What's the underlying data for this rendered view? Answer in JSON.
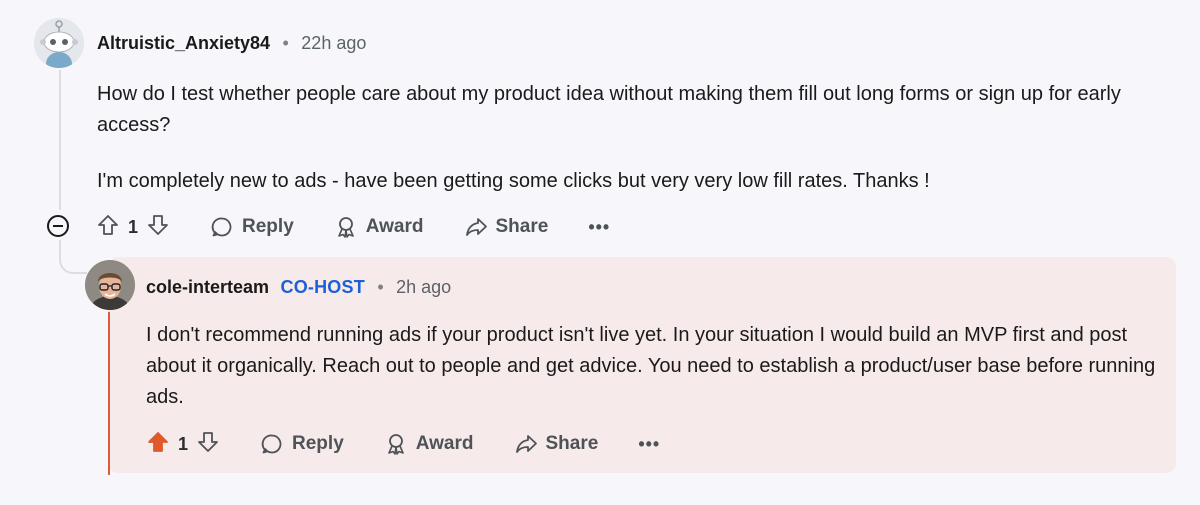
{
  "comment": {
    "author": "Altruistic_Anxiety84",
    "separator": "•",
    "time": "22h ago",
    "paragraphs": [
      "How do I test whether people care about my product idea without making them fill out long forms or sign up for early access?",
      "I'm completely new to ads - have been getting some clicks but very very low fill rates. Thanks !"
    ],
    "votes": "1",
    "actions": {
      "reply": "Reply",
      "award": "Award",
      "share": "Share",
      "more": "•••"
    }
  },
  "reply": {
    "author": "cole-interteam",
    "badge": "CO-HOST",
    "separator": "•",
    "time": "2h ago",
    "text": "I don't recommend running ads if your product isn't live yet. In your situation I would build an MVP first and post about it organically. Reach out to people and get advice. You need to establish a product/user base before running ads.",
    "votes": "1",
    "upvoted": true,
    "actions": {
      "reply": "Reply",
      "award": "Award",
      "share": "Share",
      "more": "•••"
    }
  },
  "colors": {
    "upvote_active": "#e0592a",
    "cohost_badge": "#1c5fd6",
    "reply_background": "#f7eaea"
  }
}
